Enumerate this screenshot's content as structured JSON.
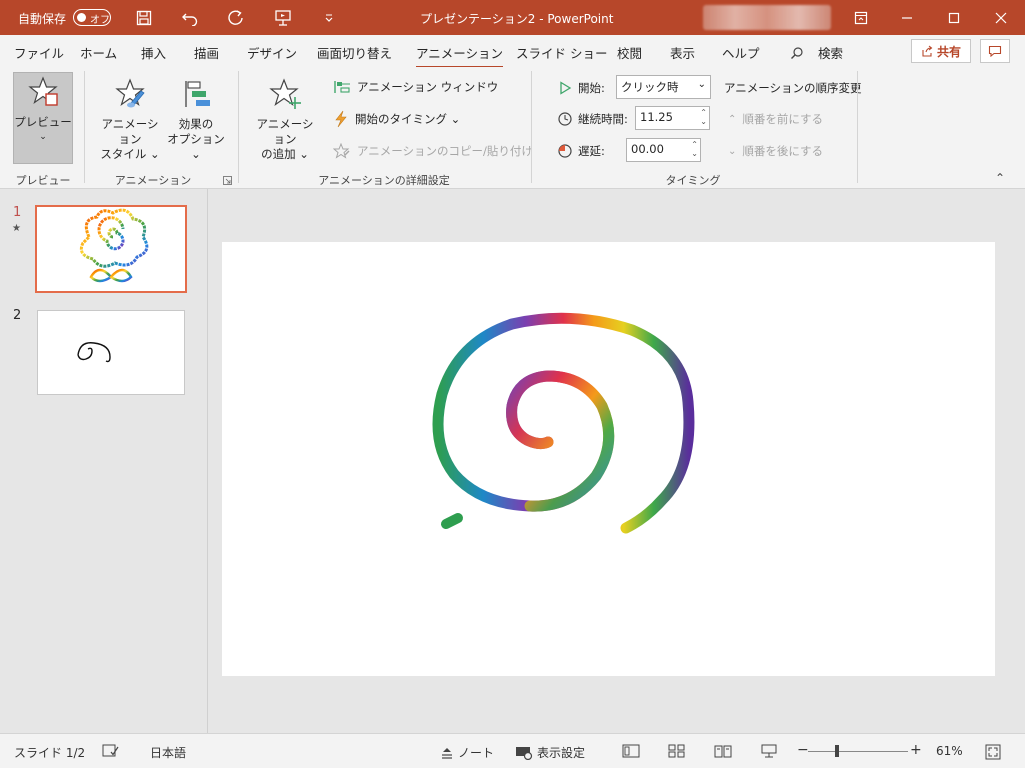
{
  "titlebar": {
    "autosave_label": "自動保存",
    "autosave_state": "オフ",
    "document_title": "プレゼンテーション2  -  PowerPoint",
    "icons": [
      "save-icon",
      "undo-icon",
      "redo-icon",
      "presenter-icon",
      "customize-qat-icon",
      "ribbon-display-icon",
      "minimize-icon",
      "maximize-icon",
      "close-icon"
    ]
  },
  "tabs": [
    {
      "label": "ファイル"
    },
    {
      "label": "ホーム"
    },
    {
      "label": "挿入"
    },
    {
      "label": "描画"
    },
    {
      "label": "デザイン"
    },
    {
      "label": "画面切り替え"
    },
    {
      "label": "アニメーション",
      "active": true
    },
    {
      "label": "スライド ショー"
    },
    {
      "label": "校閲"
    },
    {
      "label": "表示"
    },
    {
      "label": "ヘルプ"
    }
  ],
  "search_label": "検索",
  "share_label": "共有",
  "ribbon": {
    "preview": {
      "button": "プレビュー",
      "group": "プレビュー"
    },
    "animation": {
      "styles_line1": "アニメーション",
      "styles_line2": "スタイル",
      "effects_line1": "効果の",
      "effects_line2": "オプション",
      "group": "アニメーション"
    },
    "advanced": {
      "add_line1": "アニメーション",
      "add_line2": "の追加",
      "pane": "アニメーション ウィンドウ",
      "trigger": "開始のタイミング",
      "painter": "アニメーションのコピー/貼り付け",
      "group": "アニメーションの詳細設定"
    },
    "timing": {
      "start_label": "開始:",
      "start_value": "クリック時",
      "duration_label": "継続時間:",
      "duration_value": "11.25",
      "delay_label": "遅延:",
      "delay_value": "00.00",
      "reorder_title": "アニメーションの順序変更",
      "move_earlier": "順番を前にする",
      "move_later": "順番を後にする",
      "group": "タイミング"
    }
  },
  "slides": [
    {
      "number": "1",
      "selected": true,
      "has_animation": true
    },
    {
      "number": "2",
      "selected": false,
      "has_animation": false
    }
  ],
  "statusbar": {
    "slide_info": "スライド 1/2",
    "language": "日本語",
    "notes": "ノート",
    "display_settings": "表示設定",
    "zoom_level": "61%"
  },
  "colors": {
    "accent": "#b7472a",
    "ribbon_bg": "#f3f3f3",
    "pane_bg": "#e6e6e6"
  }
}
